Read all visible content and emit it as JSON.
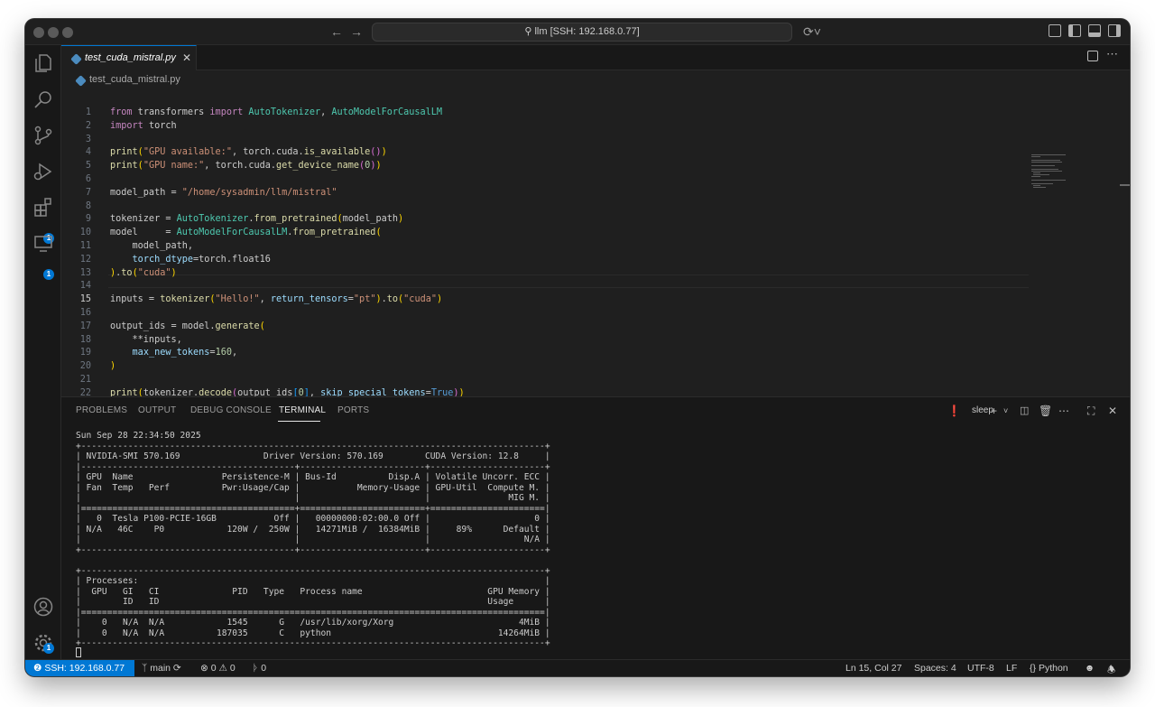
{
  "window": {
    "command_center": "llm [SSH: 192.168.0.77]"
  },
  "activity_bar": {
    "items": [
      "explorer",
      "search",
      "source-control",
      "run-debug",
      "extensions",
      "remote-explorer"
    ],
    "extensions_badge": "1",
    "remote_badge": "1",
    "settings_badge": "1"
  },
  "tabs": [
    {
      "label": "test_cuda_mistral.py",
      "active": true
    }
  ],
  "breadcrumb": {
    "file": "test_cuda_mistral.py"
  },
  "editor": {
    "active_line": 15,
    "lines": [
      {
        "n": "1",
        "html": "<span class=\"kw\">from</span> transformers <span class=\"kw\">import</span> <span class=\"cls\">AutoTokenizer</span>, <span class=\"cls\">AutoModelForCausalLM</span>"
      },
      {
        "n": "2",
        "html": "<span class=\"kw\">import</span> torch"
      },
      {
        "n": "3",
        "html": ""
      },
      {
        "n": "4",
        "html": "<span class=\"fn\">print</span><span class=\"par\">(</span><span class=\"str\">\"GPU available:\"</span>, torch.cuda.<span class=\"fn\">is_available</span><span class=\"par2\">()</span><span class=\"par\">)</span>"
      },
      {
        "n": "5",
        "html": "<span class=\"fn\">print</span><span class=\"par\">(</span><span class=\"str\">\"GPU name:\"</span>, torch.cuda.<span class=\"fn\">get_device_name</span><span class=\"par2\">(</span><span class=\"num\">0</span><span class=\"par2\">)</span><span class=\"par\">)</span>"
      },
      {
        "n": "6",
        "html": ""
      },
      {
        "n": "7",
        "html": "model_path = <span class=\"str\">\"/home/sysadmin/llm/mistral\"</span>"
      },
      {
        "n": "8",
        "html": ""
      },
      {
        "n": "9",
        "html": "tokenizer = <span class=\"cls\">AutoTokenizer</span>.<span class=\"fn\">from_pretrained</span><span class=\"par\">(</span>model_path<span class=\"par\">)</span>"
      },
      {
        "n": "10",
        "html": "model     = <span class=\"cls\">AutoModelForCausalLM</span>.<span class=\"fn\">from_pretrained</span><span class=\"par\">(</span>"
      },
      {
        "n": "11",
        "html": "    model_path,"
      },
      {
        "n": "12",
        "html": "    <span class=\"param\">torch_dtype</span>=torch.float16"
      },
      {
        "n": "13",
        "html": "<span class=\"par\">)</span>.<span class=\"fn\">to</span><span class=\"par\">(</span><span class=\"str\">\"cuda\"</span><span class=\"par\">)</span>"
      },
      {
        "n": "14",
        "html": ""
      },
      {
        "n": "15",
        "html": "inputs = <span class=\"fn\">tokenizer</span><span class=\"par\">(</span><span class=\"str\">\"Hello!\"</span>, <span class=\"param\">return_tensors</span>=<span class=\"str\">\"pt\"</span><span class=\"par\">)</span>.<span class=\"fn\">to</span><span class=\"par\">(</span><span class=\"str\">\"cuda\"</span><span class=\"par\">)</span>"
      },
      {
        "n": "16",
        "html": ""
      },
      {
        "n": "17",
        "html": "output_ids = model.<span class=\"fn\">generate</span><span class=\"par\">(</span>"
      },
      {
        "n": "18",
        "html": "    **inputs,"
      },
      {
        "n": "19",
        "html": "    <span class=\"param\">max_new_tokens</span>=<span class=\"num\">160</span>,"
      },
      {
        "n": "20",
        "html": "<span class=\"par\">)</span>"
      },
      {
        "n": "21",
        "html": ""
      },
      {
        "n": "22",
        "html": "<span class=\"fn\">print</span><span class=\"par\">(</span>tokenizer.<span class=\"fn\">decode</span><span class=\"par2\">(</span>output_ids<span class=\"par3\">[</span><span class=\"num\">0</span><span class=\"par3\">]</span>, <span class=\"param\">skip_special_tokens</span>=<span class=\"kw2\">True</span><span class=\"par2\">)</span><span class=\"par\">)</span>"
      }
    ]
  },
  "panel": {
    "tabs": [
      "PROBLEMS",
      "OUTPUT",
      "DEBUG CONSOLE",
      "TERMINAL",
      "PORTS"
    ],
    "active_tab": "TERMINAL",
    "terminal_name": "sleep",
    "terminal_text": "Sun Sep 28 22:34:50 2025\n+-----------------------------------------------------------------------------------------+\n| NVIDIA-SMI 570.169                Driver Version: 570.169        CUDA Version: 12.8     |\n|-----------------------------------------+------------------------+----------------------+\n| GPU  Name                 Persistence-M | Bus-Id          Disp.A | Volatile Uncorr. ECC |\n| Fan  Temp   Perf          Pwr:Usage/Cap |           Memory-Usage | GPU-Util  Compute M. |\n|                                         |                        |               MIG M. |\n|=========================================+========================+======================|\n|   0  Tesla P100-PCIE-16GB           Off |   00000000:02:00.0 Off |                    0 |\n| N/A   46C    P0            120W /  250W |   14271MiB /  16384MiB |     89%      Default |\n|                                         |                        |                  N/A |\n+-----------------------------------------+------------------------+----------------------+\n\n+-----------------------------------------------------------------------------------------+\n| Processes:                                                                              |\n|  GPU   GI   CI              PID   Type   Process name                        GPU Memory |\n|        ID   ID                                                               Usage      |\n|=========================================================================================|\n|    0   N/A  N/A            1545      G   /usr/lib/xorg/Xorg                        4MiB |\n|    0   N/A  N/A          187035      C   python                                14264MiB |\n+-----------------------------------------------------------------------------------------+"
  },
  "status_bar": {
    "remote": "SSH: 192.168.0.77",
    "branch": "main",
    "errors": "0",
    "warnings": "0",
    "ports": "0",
    "position": "Ln 15, Col 27",
    "spaces": "Spaces: 4",
    "encoding": "UTF-8",
    "eol": "LF",
    "language": "Python"
  },
  "colors": {
    "accent": "#0078d4",
    "background": "#1f1f1f",
    "sidebar": "#181818"
  }
}
